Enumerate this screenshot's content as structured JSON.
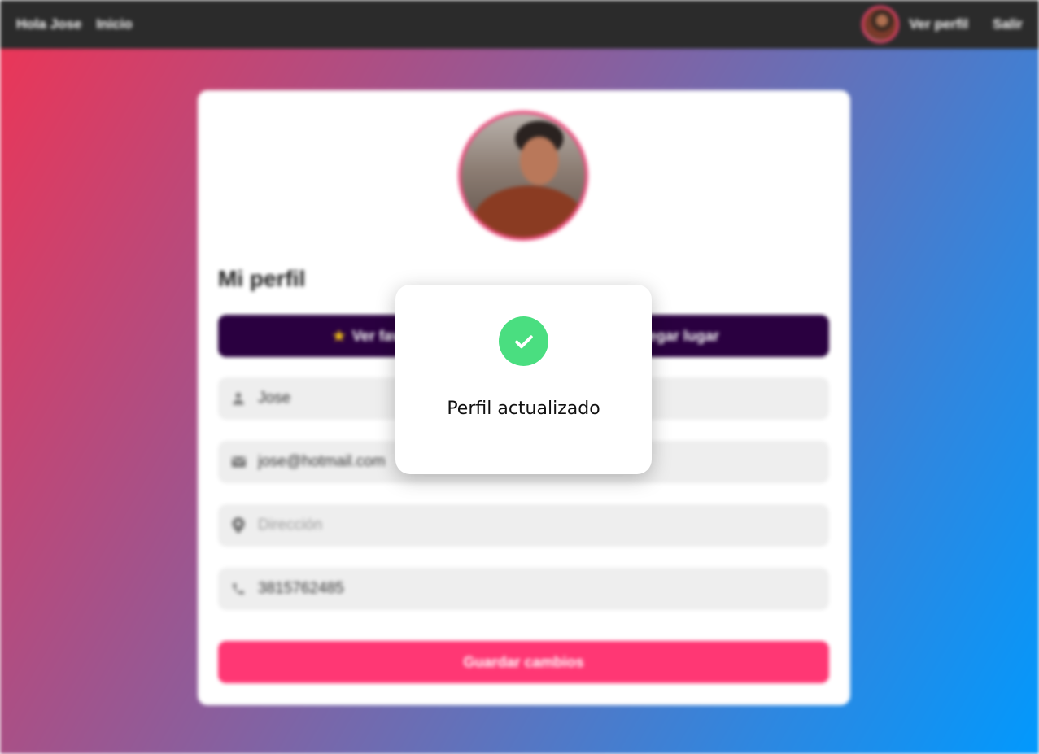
{
  "navbar": {
    "greeting": "Hola Jose",
    "home_link": "Inicio",
    "profile_link": "Ver perfil",
    "logout_link": "Salir"
  },
  "profile": {
    "title": "Mi perfil",
    "actions": {
      "favorites_label": "Ver favo",
      "add_place_label": "gregar lugar"
    },
    "fields": {
      "name": {
        "value": "Jose",
        "icon": "person-icon"
      },
      "email": {
        "value": "jose@hotmail.com",
        "icon": "mail-icon"
      },
      "address": {
        "value": "",
        "placeholder": "Dirección",
        "icon": "location-pin-icon"
      },
      "phone": {
        "value": "3815762485",
        "icon": "phone-icon"
      }
    },
    "save_label": "Guardar cambios"
  },
  "modal": {
    "icon": "check-circle-icon",
    "message": "Perfil actualizado"
  },
  "colors": {
    "navbar": "#2b2b2b",
    "gradient_start": "#ea3658",
    "gradient_end": "#0199fd",
    "action_bar": "#2a0040",
    "save_button": "#ff3774",
    "success": "#4ade80"
  }
}
